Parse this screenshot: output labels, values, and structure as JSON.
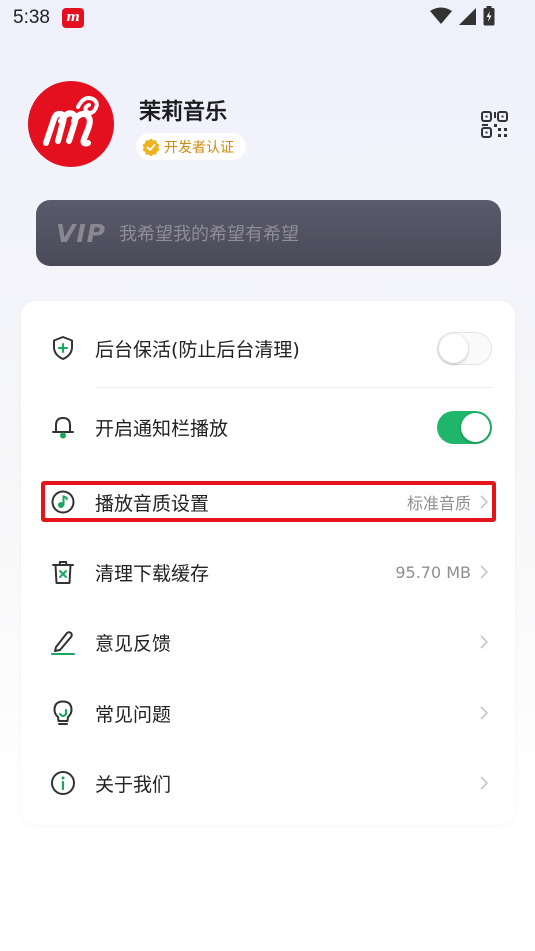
{
  "status_bar": {
    "time": "5:38",
    "app_icon_letter": "m",
    "icons": [
      "wifi-icon",
      "signal-icon",
      "battery-icon"
    ]
  },
  "profile": {
    "app_name": "茉莉音乐",
    "badge": "开发者认证",
    "logo_color": "#e4101f"
  },
  "vip": {
    "logo": "VIP",
    "text": "我希望我的希望有希望"
  },
  "settings": {
    "items": [
      {
        "label": "后台保活(防止后台清理)",
        "icon": "shield-plus-icon",
        "control": "toggle",
        "enabled": false
      },
      {
        "label": "开启通知栏播放",
        "icon": "bell-icon",
        "control": "toggle",
        "enabled": true
      },
      {
        "label": "播放音质设置",
        "icon": "music-note-icon",
        "value": "标准音质",
        "control": "chevron"
      },
      {
        "label": "清理下载缓存",
        "icon": "trash-icon",
        "value": "95.70 MB",
        "control": "chevron"
      },
      {
        "label": "意见反馈",
        "icon": "pencil-icon",
        "value": "",
        "control": "chevron"
      },
      {
        "label": "常见问题",
        "icon": "lightbulb-icon",
        "value": "",
        "control": "chevron"
      },
      {
        "label": "关于我们",
        "icon": "info-icon",
        "value": "",
        "control": "chevron"
      }
    ]
  },
  "colors": {
    "accent_green": "#1fb56a",
    "highlight_red": "#e5141b",
    "vip_bg": "#4a4a58"
  }
}
